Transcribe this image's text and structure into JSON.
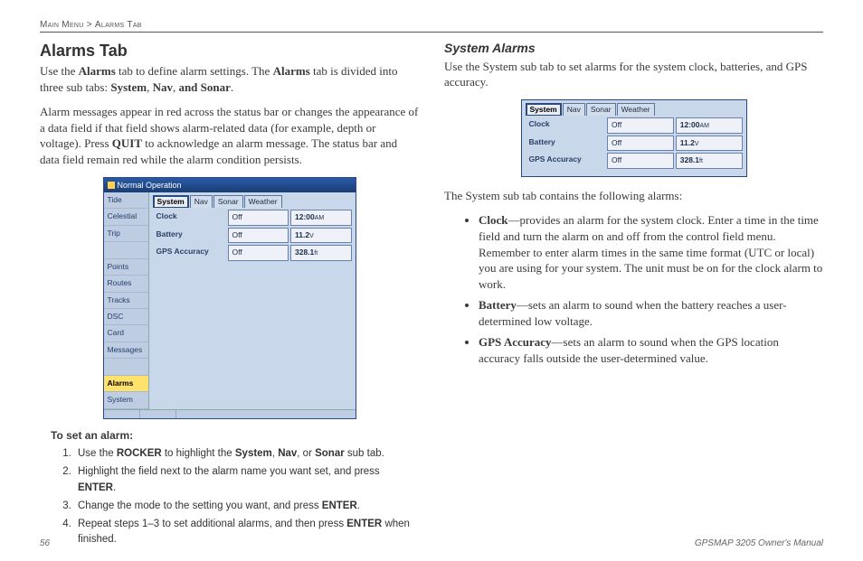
{
  "breadcrumb": {
    "left": "Main Menu",
    "sep": ">",
    "right": "Alarms Tab"
  },
  "left": {
    "h2": "Alarms Tab",
    "p1a": "Use the ",
    "p1b": "Alarms",
    "p1c": " tab to define alarm settings. The ",
    "p1d": "Alarms",
    "p1e": " tab is divided into three sub tabs: ",
    "p1f": "System",
    "p1g": ", ",
    "p1h": "Nav",
    "p1i": ", ",
    "p1j": "and Sonar",
    "p1k": ".",
    "p2a": "Alarm messages appear in red across the status bar or changes the appearance of a data field if that field shows alarm-related data (for example, depth or voltage). Press ",
    "p2b": "QUIT",
    "p2c": " to acknowledge an alarm message. The status bar and data field remain red while the alarm condition persists.",
    "steps_title": "To set an alarm:",
    "steps": [
      {
        "a": "Use the ",
        "b": "ROCKER",
        "c": " to highlight the ",
        "d": "System",
        "e": ", ",
        "f": "Nav",
        "g": ", or ",
        "h": "Sonar",
        "i": " sub tab."
      },
      {
        "a": "Highlight the field next to the alarm name you want set, and press ",
        "b": "ENTER",
        "c": "."
      },
      {
        "a": "Change the mode to the setting you want, and press ",
        "b": "ENTER",
        "c": "."
      },
      {
        "a": "Repeat steps 1–3 to set additional alarms, and then press ",
        "b": "ENTER",
        "c": " when finished."
      }
    ]
  },
  "right": {
    "h3": "System Alarms",
    "p1": "Use the System sub tab to set alarms for the system clock, batteries, and GPS accuracy.",
    "p2": "The System sub tab contains the following alarms:",
    "bullets": [
      {
        "b": "Clock",
        "t": "—provides an alarm for the system clock. Enter a time in the time field and turn the alarm on and off from the control field menu. Remember to enter alarm times in the same time format (UTC or local) you are using for your system. The unit must be on for the clock alarm to work."
      },
      {
        "b": "Battery",
        "t": "—sets an alarm to sound when the battery reaches a user-determined low voltage."
      },
      {
        "b": "GPS Accuracy",
        "t": "—sets an alarm to sound when the GPS location accuracy falls outside the user-determined value."
      }
    ]
  },
  "win_big": {
    "title": "Normal Operation",
    "sidebar": [
      "Tide",
      "Celestial",
      "Trip",
      "",
      "Points",
      "Routes",
      "Tracks",
      "DSC",
      "Card",
      "Messages",
      "",
      "Alarms",
      "System"
    ],
    "sidebar_dim": [
      3,
      10
    ],
    "sidebar_hl": 11,
    "subtabs": [
      "System",
      "Nav",
      "Sonar",
      "Weather"
    ],
    "active_tab": 0,
    "rows": [
      {
        "label": "Clock",
        "mode": "Off",
        "val": "12:00",
        "unit": "AM"
      },
      {
        "label": "Battery",
        "mode": "Off",
        "val": "11.2",
        "unit": "V"
      },
      {
        "label": "GPS Accuracy",
        "mode": "Off",
        "val": "328.1",
        "unit": "ft"
      }
    ]
  },
  "win_small": {
    "subtabs": [
      "System",
      "Nav",
      "Sonar",
      "Weather"
    ],
    "active_tab": 0,
    "rows": [
      {
        "label": "Clock",
        "mode": "Off",
        "val": "12:00",
        "unit": "AM"
      },
      {
        "label": "Battery",
        "mode": "Off",
        "val": "11.2",
        "unit": "V"
      },
      {
        "label": "GPS Accuracy",
        "mode": "Off",
        "val": "328.1",
        "unit": "ft"
      }
    ]
  },
  "footer": {
    "page": "56",
    "manual": "GPSMAP 3205 Owner's Manual"
  }
}
